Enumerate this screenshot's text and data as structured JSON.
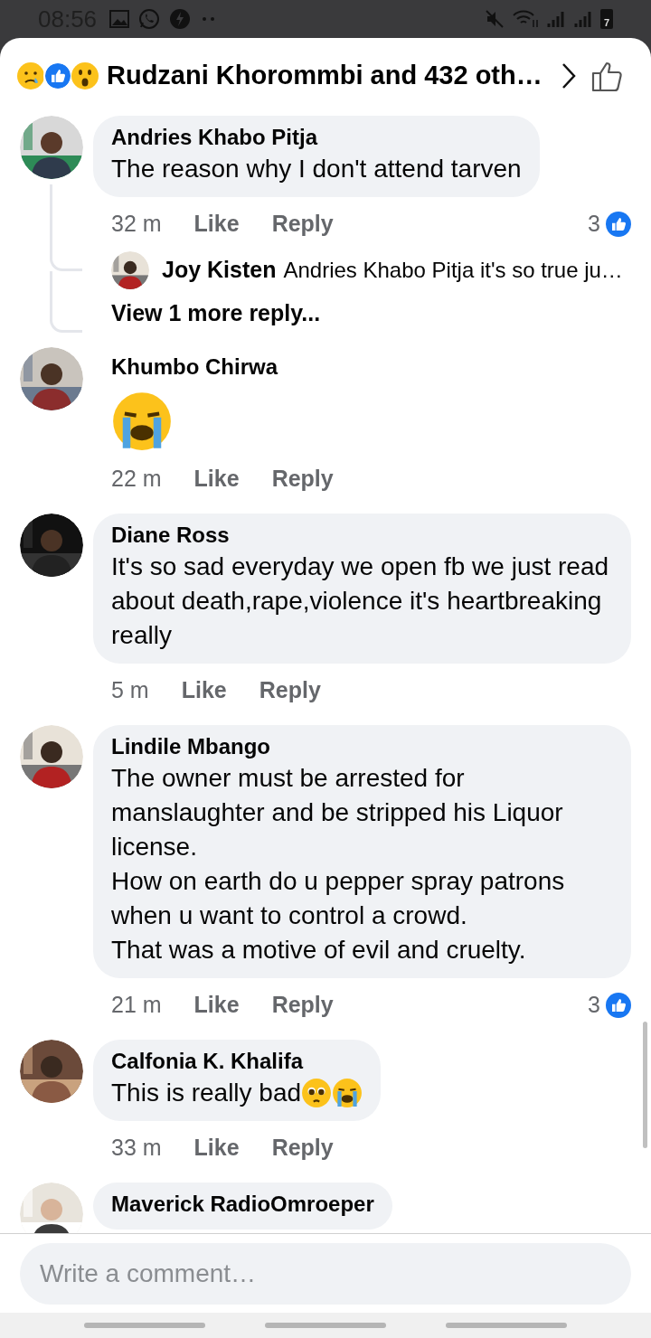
{
  "status_bar": {
    "time": "08:56",
    "battery": "7"
  },
  "header": {
    "title": "Rudzani Khorommbi and 432 oth…"
  },
  "comments": [
    {
      "kind": "text",
      "author": "Andries Khabo Pitja",
      "text": "The reason why I don't attend tarven",
      "time": "32 m",
      "actions": [
        "Like",
        "Reply"
      ],
      "reaction_count": "3",
      "replies": [
        {
          "author": "Joy Kisten",
          "text": "Andries Khabo Pitja it's so true ju…"
        }
      ],
      "more_replies": "View 1 more reply..."
    },
    {
      "kind": "emoji",
      "author": "Khumbo Chirwa",
      "time": "22 m",
      "actions": [
        "Like",
        "Reply"
      ]
    },
    {
      "kind": "text",
      "author": "Diane Ross",
      "text": "It's so sad everyday we open fb we just read about death,rape,violence it's heartbreaking really",
      "time": "5 m",
      "actions": [
        "Like",
        "Reply"
      ]
    },
    {
      "kind": "text",
      "author": "Lindile Mbango",
      "text": "The owner must be arrested for manslaughter and be stripped his Liquor license.\nHow on earth do u pepper spray patrons when u want to control a crowd.\nThat was a motive of evil and cruelty.",
      "time": "21 m",
      "actions": [
        "Like",
        "Reply"
      ],
      "reaction_count": "3"
    },
    {
      "kind": "text",
      "author": "Calfonia K. Khalifa",
      "text": "This is really bad",
      "trailing_emoji": true,
      "time": "33 m",
      "actions": [
        "Like",
        "Reply"
      ]
    },
    {
      "kind": "text",
      "author": "Maverick RadioOmroeper"
    }
  ],
  "composer": {
    "placeholder": "Write a comment…"
  }
}
